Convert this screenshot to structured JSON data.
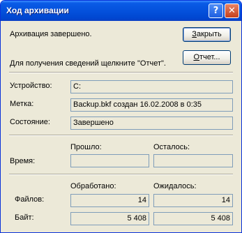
{
  "window": {
    "title": "Ход архивации",
    "help_glyph": "?",
    "close_glyph": "✕"
  },
  "status": {
    "message": "Архивация завершено.",
    "report_hint": "Для получения сведений щелкните \"Отчет\"."
  },
  "buttons": {
    "close": {
      "underlined": "З",
      "rest": "акрыть"
    },
    "report": {
      "underlined": "О",
      "rest": "тчет..."
    }
  },
  "info": {
    "device_label": "Устройство:",
    "device_value": "C:",
    "label_label": "Метка:",
    "label_value": "Backup.bkf создан 16.02.2008 в 0:35",
    "state_label": "Состояние:",
    "state_value": "Завершено"
  },
  "time": {
    "row_label": "Время:",
    "elapsed_header": "Прошло:",
    "elapsed_value": "",
    "remaining_header": "Осталось:",
    "remaining_value": ""
  },
  "counts": {
    "processed_header": "Обработано:",
    "expected_header": "Ожидалось:",
    "files_label": "Файлов:",
    "files_processed": "14",
    "files_expected": "14",
    "bytes_label": "Байт:",
    "bytes_processed": "5 408",
    "bytes_expected": "5 408"
  },
  "colors": {
    "title_bar": "#0451dc",
    "dialog_bg": "#ece9d8",
    "field_border": "#7f9db9",
    "close_button": "#c4401d"
  }
}
